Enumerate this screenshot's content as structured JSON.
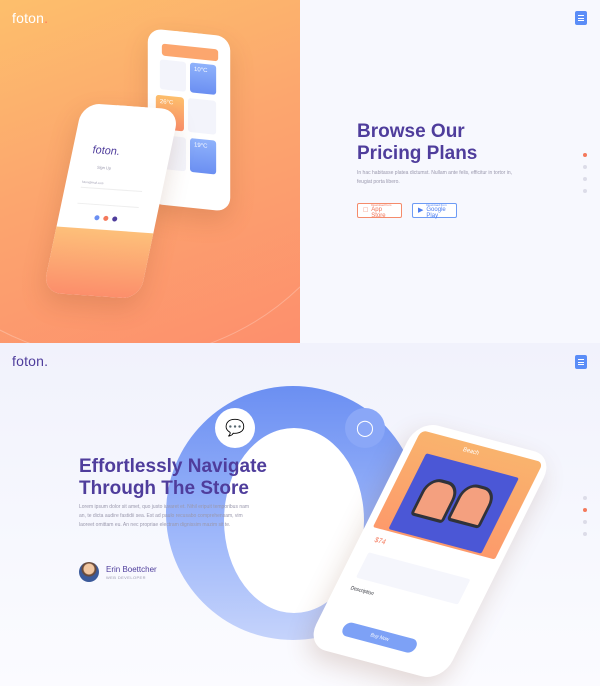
{
  "top": {
    "logo": "foton",
    "logo_dot": ".",
    "title_line1": "Browse Our",
    "title_line2": "Pricing Plans",
    "paragraph": "In hac habitasse platea dictumst. Nullam ante felis, efficitur in tortor in, feugiat porta libero.",
    "apple_small": "Download from",
    "apple_large": "App Store",
    "google_small": "Download from",
    "google_large": "Google Play",
    "phone_app_name": "foton.",
    "phone_signup": "Sign Up",
    "phone_email": "foton@mail.com",
    "phone_tab1": "Sign up",
    "phone_tab2": "Login",
    "card1_value": "10°C",
    "card2_value": "26°C",
    "card3_value": "19°C",
    "slides": [
      {
        "active": true
      },
      {
        "active": false
      },
      {
        "active": false
      },
      {
        "active": false
      }
    ]
  },
  "bottom": {
    "logo": "foton.",
    "title_line1": "Effortlessly Navigate",
    "title_line2": "Through The Store",
    "paragraph": "Lorem ipsum dolor sit amet, quo justo iuvaret et. Nihil eripuit temporibus nam an, te dicta audire fastidii sea. Est ad paulo recusabo comprehensam, vim laoreet omittam eu. An nec propriae electram dignissim mazim sit te.",
    "author_name": "Erin Boettcher",
    "author_role": "WEB DEVELOPER",
    "phone_header": "Beach",
    "phone_price": "$74",
    "phone_desc_title": "Description",
    "phone_buy": "Buy Now",
    "chat_icon": "chat-bubble-icon",
    "headphones_icon": "headphones-icon",
    "slides": [
      {
        "active": false
      },
      {
        "active": true
      },
      {
        "active": false
      },
      {
        "active": false
      }
    ]
  },
  "colors": {
    "accent_purple": "#4f3d9c",
    "accent_blue": "#5b8df7",
    "accent_orange": "#f4795c"
  }
}
